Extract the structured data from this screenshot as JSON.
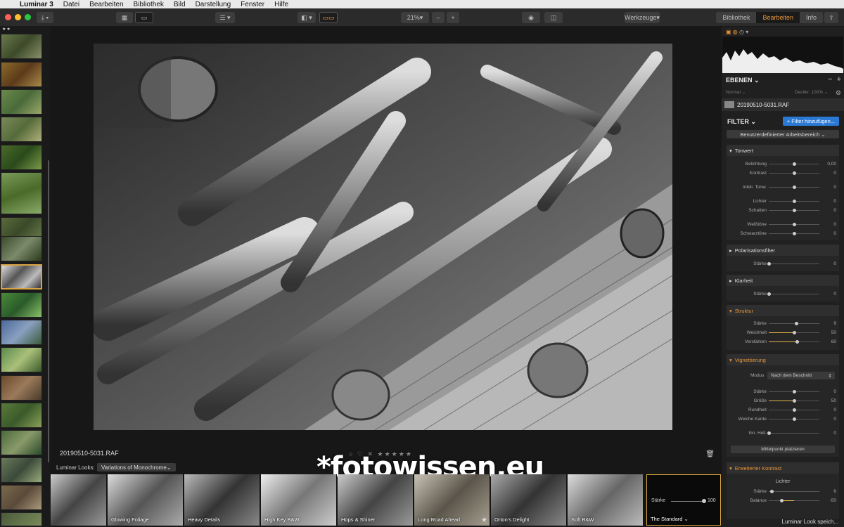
{
  "menubar": {
    "app": "Luminar 3",
    "items": [
      "Datei",
      "Bearbeiten",
      "Bibliothek",
      "Bild",
      "Darstellung",
      "Fenster",
      "Hilfe"
    ]
  },
  "toolbar": {
    "zoom": "21%",
    "zoom_minus": "–",
    "zoom_plus": "+",
    "tools": "Werkzeuge",
    "tabs": [
      "Bibliothek",
      "Bearbeiten",
      "Info"
    ]
  },
  "filmstrip": {
    "stars": "★★"
  },
  "center": {
    "filename": "20190510-5031.RAF",
    "rating": "○ ♡ ✕ ★★★★★",
    "watermark": "*fotowissen.eu",
    "looks_label": "Luminar Looks:",
    "looks_select": "Variations of Monochrome",
    "looks": [
      {
        "name": "",
        "selected": false
      },
      {
        "name": "Glowing Foliage",
        "selected": false
      },
      {
        "name": "Heavy Details",
        "selected": false
      },
      {
        "name": "High Key B&W",
        "selected": false
      },
      {
        "name": "Hops & Shiner",
        "selected": false
      },
      {
        "name": "Long Road Ahead",
        "selected": false
      },
      {
        "name": "Orton's Delight",
        "selected": false
      },
      {
        "name": "Soft B&W",
        "selected": false
      },
      {
        "name": "The Standard ⌄",
        "selected": true
      }
    ],
    "selected_look_strength_label": "Stärke",
    "selected_look_strength_value": "100"
  },
  "panel": {
    "layers_title": "EBENEN ⌄",
    "blend": "Normal ⌄",
    "opacity": "Deckkr. 100% ⌄",
    "layer_name": "20190510-5031.RAF",
    "filter_title": "FILTER ⌄",
    "add_filter": "+ Filter hinzufügen...",
    "workspace": "Benutzerdefinierter Arbeitsbereich ⌄",
    "sections": {
      "tonwert": {
        "title": "Tonwert",
        "sliders": [
          {
            "label": "Belichtung",
            "value": "0,00",
            "level": 0.5
          },
          {
            "label": "Kontrast",
            "value": "0",
            "level": 0.5
          },
          {
            "label": "Inteli. Tonw.",
            "value": "0",
            "level": 0.5
          },
          {
            "label": "Lichter",
            "value": "0",
            "level": 0.5
          },
          {
            "label": "Schatten",
            "value": "0",
            "level": 0.5
          },
          {
            "label": "Weißtöne",
            "value": "0",
            "level": 0.5
          },
          {
            "label": "Schwarztöne",
            "value": "0",
            "level": 0.5
          }
        ]
      },
      "polar": {
        "title": "Polarisationsfilter",
        "sliders": [
          {
            "label": "Stärke",
            "value": "0",
            "level": 0
          }
        ]
      },
      "klarheit": {
        "title": "Klarheit",
        "sliders": [
          {
            "label": "Stärke",
            "value": "0",
            "level": 0
          }
        ]
      },
      "struktur": {
        "title": "Struktur",
        "sliders": [
          {
            "label": "Stärke",
            "value": "9",
            "level": 0.55
          },
          {
            "label": "Weichheit",
            "value": "50",
            "level": 0.5
          },
          {
            "label": "Verstärken",
            "value": "60",
            "level": 0.6
          }
        ]
      },
      "vignette": {
        "title": "Vignettierung",
        "modus_label": "Modus",
        "modus_value": "Nach dem Beschnitt",
        "sliders": [
          {
            "label": "Stärke",
            "value": "0",
            "level": 0.5
          },
          {
            "label": "Größe",
            "value": "50",
            "level": 0.5
          },
          {
            "label": "Rundheit",
            "value": "0",
            "level": 0.5
          },
          {
            "label": "Weiche Kante",
            "value": "0",
            "level": 0.5
          },
          {
            "label": "Inn. Hell.",
            "value": "0",
            "level": 0
          }
        ],
        "button": "Mittelpunkt platzieren"
      },
      "kontrast": {
        "title": "Erweiterter Kontrast",
        "group": "Lichter",
        "sliders": [
          {
            "label": "Stärke",
            "value": "6",
            "level": 0.06
          },
          {
            "label": "Balance",
            "value": "-50",
            "level": 0.25
          }
        ]
      }
    },
    "status": "Luminar Look speich..."
  },
  "colors": {
    "accent": "#e8943a",
    "blue": "#2a7ad5",
    "gold": "#d9a441"
  }
}
